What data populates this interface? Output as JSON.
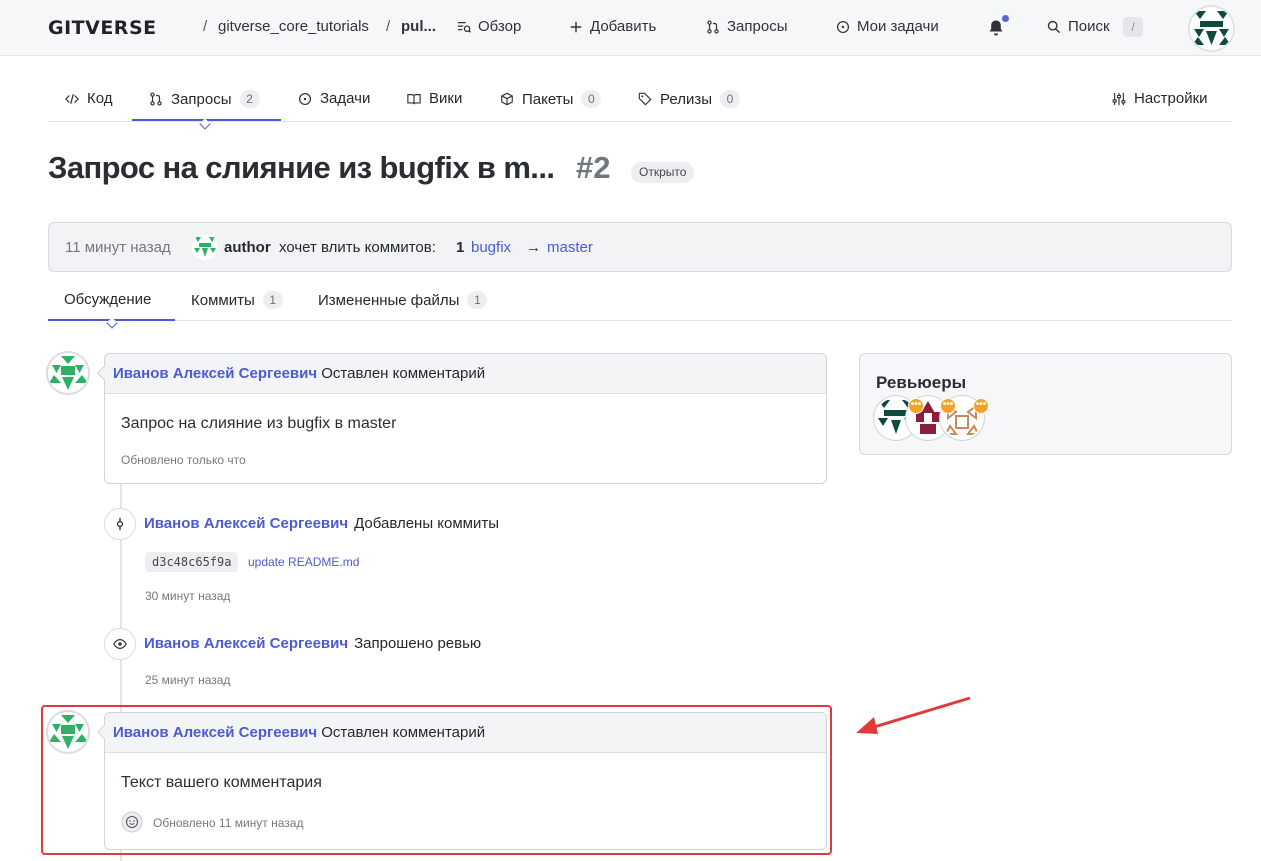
{
  "header": {
    "logo": "GITVERSE",
    "breadcrumb": [
      "gitverse_core_tutorials",
      "pul..."
    ],
    "breadcrumb_sep": "/",
    "nav": [
      {
        "label": "Обзор",
        "icon": "overview-icon"
      },
      {
        "label": "Добавить",
        "icon": "plus-icon"
      },
      {
        "label": "Запросы",
        "icon": "pull-request-icon"
      },
      {
        "label": "Мои задачи",
        "icon": "issue-icon"
      }
    ],
    "search_label": "Поиск",
    "search_shortcut": "/",
    "notification_dot_color": "#5b63d3"
  },
  "repo_tabs": [
    {
      "label": "Код",
      "icon": "code-icon",
      "count": null
    },
    {
      "label": "Запросы",
      "icon": "pull-request-icon",
      "count": "2"
    },
    {
      "label": "Задачи",
      "icon": "issue-icon",
      "count": null
    },
    {
      "label": "Вики",
      "icon": "book-icon",
      "count": null
    },
    {
      "label": "Пакеты",
      "icon": "package-icon",
      "count": "0"
    },
    {
      "label": "Релизы",
      "icon": "tag-icon",
      "count": "0"
    }
  ],
  "settings_label": "Настройки",
  "pr": {
    "title": "Запрос на слияние из bugfix в m...",
    "number": "#2",
    "state": "Открыто",
    "info": {
      "time": "11 минут назад",
      "author": "author",
      "action": "хочет влить коммитов:",
      "commit_count": "1",
      "source_branch": "bugfix",
      "arrow": "→",
      "target_branch": "master"
    }
  },
  "sub_tabs": [
    {
      "label": "Обсуждение",
      "count": null
    },
    {
      "label": "Коммиты",
      "count": "1"
    },
    {
      "label": "Измененные файлы",
      "count": "1"
    }
  ],
  "timeline": {
    "comment1": {
      "author": "Иванов Алексей Сергеевич",
      "action": "Оставлен комментарий",
      "text": "Запрос на слияние из bugfix в master",
      "meta": "Обновлено только что"
    },
    "event_commits": {
      "author": "Иванов Алексей Сергеевич",
      "action": "Добавлены коммиты",
      "sha": "d3c48c65f9a",
      "message": "update README.md",
      "time": "30 минут назад"
    },
    "event_review": {
      "author": "Иванов Алексей Сергеевич",
      "action": "Запрошено ревью",
      "time": "25 минут назад"
    },
    "comment2": {
      "author": "Иванов Алексей Сергеевич",
      "action": "Оставлен комментарий",
      "text": "Текст вашего комментария",
      "meta": "Обновлено 11 минут назад"
    }
  },
  "reviewers": {
    "title": "Ревьюеры",
    "pending_badge": "•••",
    "pending_color": "#f0a326"
  },
  "colors": {
    "accent": "#4c5bd4",
    "annotation": "#e03b3b"
  }
}
